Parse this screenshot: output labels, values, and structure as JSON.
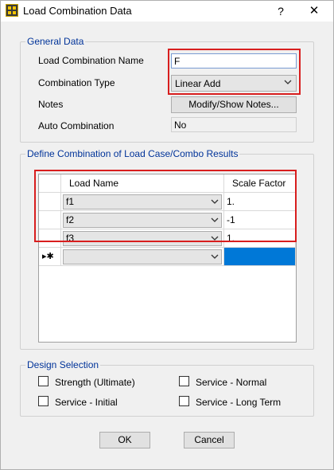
{
  "window": {
    "title": "Load Combination Data",
    "help_label": "?",
    "close_label": "✕"
  },
  "general": {
    "legend": "General Data",
    "name_label": "Load Combination Name",
    "name_value": "F",
    "type_label": "Combination Type",
    "type_value": "Linear Add",
    "notes_label": "Notes",
    "notes_button": "Modify/Show Notes...",
    "auto_label": "Auto Combination",
    "auto_value": "No"
  },
  "combo": {
    "legend": "Define Combination of Load Case/Combo Results",
    "col_name": "Load Name",
    "col_factor": "Scale Factor",
    "rows": [
      {
        "name": "f1",
        "factor": "1."
      },
      {
        "name": "f2",
        "factor": "-1"
      },
      {
        "name": "f3",
        "factor": "1."
      }
    ],
    "new_row_marker": "▸✱"
  },
  "design": {
    "legend": "Design Selection",
    "strength": "Strength (Ultimate)",
    "service_initial": "Service - Initial",
    "service_normal": "Service - Normal",
    "service_long": "Service - Long Term"
  },
  "buttons": {
    "ok": "OK",
    "cancel": "Cancel"
  },
  "icons": {
    "app": "sap-app-icon",
    "dropdown": "chevron-down-icon"
  },
  "colors": {
    "highlight": "#d81e1e",
    "selection": "#0078d7",
    "legend_text": "#003399"
  }
}
